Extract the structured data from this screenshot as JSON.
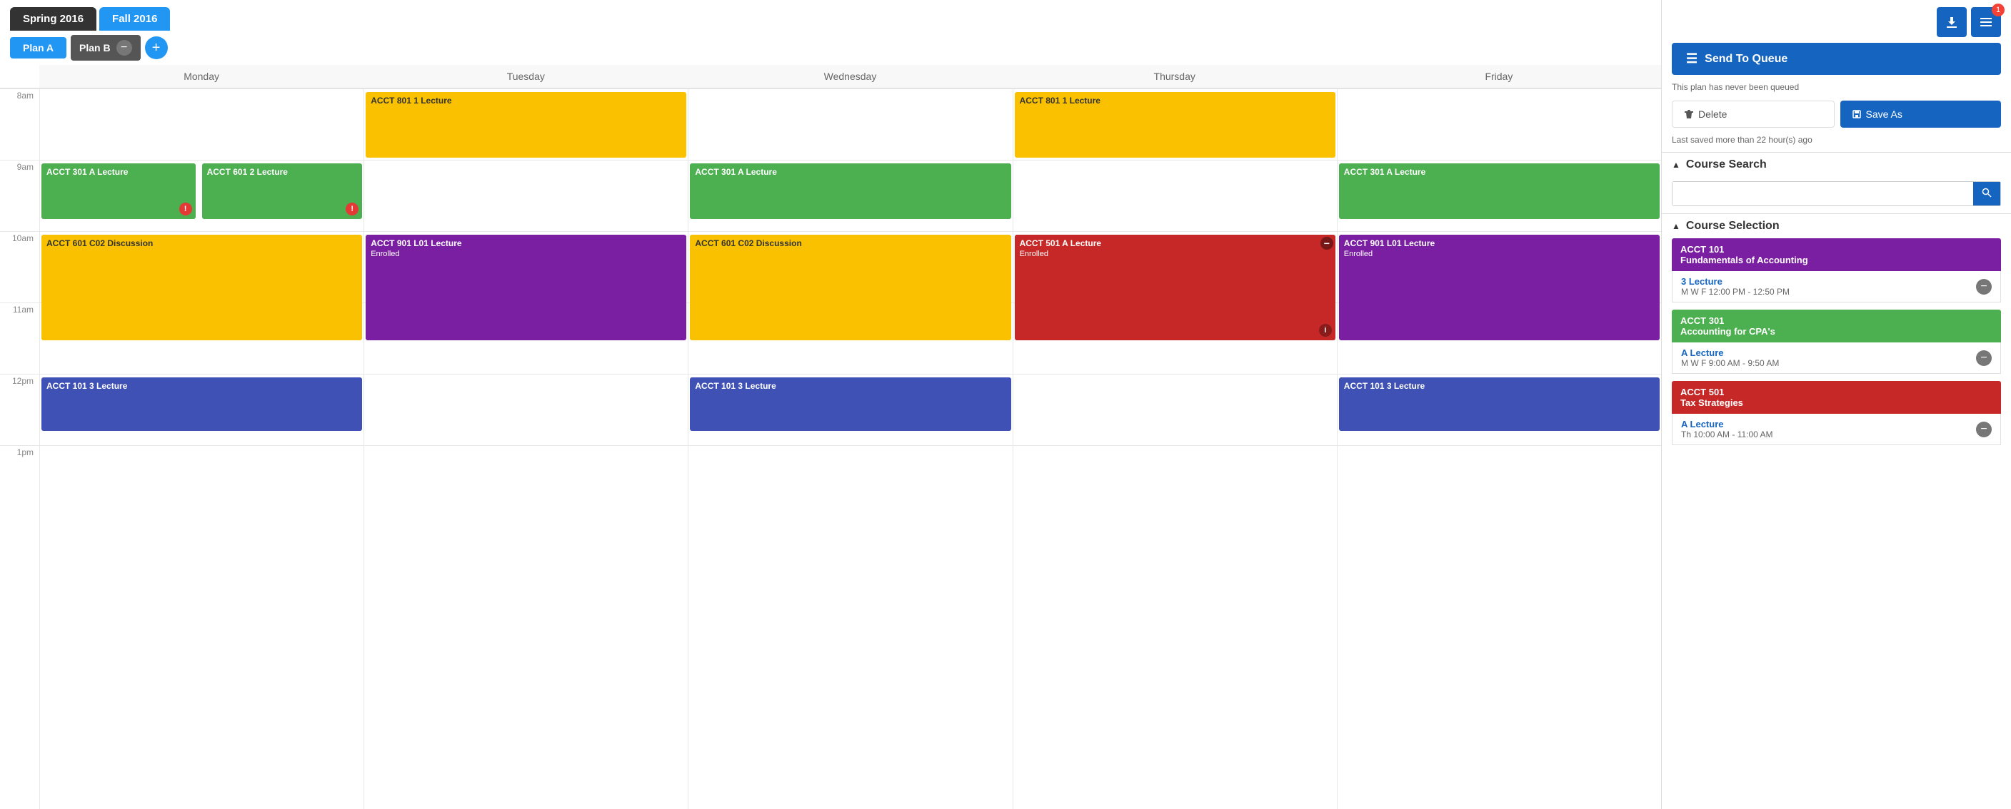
{
  "semesters": [
    {
      "label": "Spring 2016",
      "active": false
    },
    {
      "label": "Fall 2016",
      "active": true
    }
  ],
  "plans": [
    {
      "label": "Plan A",
      "active": true
    },
    {
      "label": "Plan B",
      "active": false
    }
  ],
  "calendar": {
    "days": [
      "Monday",
      "Tuesday",
      "Wednesday",
      "Thursday",
      "Friday"
    ],
    "times": [
      "8am",
      "9am",
      "10am",
      "11am",
      "12pm",
      "1pm"
    ],
    "courses": [
      {
        "id": "acct801-tue",
        "label": "ACCT 801 1 Lecture",
        "day": 1,
        "startSlot": 0,
        "height": 1,
        "color": "yellow",
        "enrolled": false
      },
      {
        "id": "acct801-thu",
        "label": "ACCT 801 1 Lecture",
        "day": 3,
        "startSlot": 0,
        "height": 1,
        "color": "yellow",
        "enrolled": false
      },
      {
        "id": "acct301-mon",
        "label": "ACCT 301 A Lecture",
        "day": 0,
        "startSlot": 1,
        "height": 0.8,
        "color": "green",
        "enrolled": false,
        "hasError": true
      },
      {
        "id": "acct601-mon",
        "label": "ACCT 601 2 Lecture",
        "day": 0,
        "startSlot": 1,
        "height": 0.8,
        "color": "green",
        "enrolled": false,
        "hasError": true,
        "offset": true
      },
      {
        "id": "acct301-wed",
        "label": "ACCT 301 A Lecture",
        "day": 2,
        "startSlot": 1,
        "height": 0.8,
        "color": "green",
        "enrolled": false
      },
      {
        "id": "acct301-fri",
        "label": "ACCT 301 A Lecture",
        "day": 4,
        "startSlot": 1,
        "height": 0.8,
        "color": "green",
        "enrolled": false
      },
      {
        "id": "acct601-mon-disc",
        "label": "ACCT 601 C02 Discussion",
        "day": 0,
        "startSlot": 2,
        "height": 1.5,
        "color": "yellow2",
        "enrolled": false
      },
      {
        "id": "acct901-tue",
        "label": "ACCT 901 L01 Lecture",
        "sub": "Enrolled",
        "day": 1,
        "startSlot": 2,
        "height": 1.5,
        "color": "purple",
        "enrolled": true
      },
      {
        "id": "acct601-wed-disc",
        "label": "ACCT 601 C02 Discussion",
        "day": 2,
        "startSlot": 2,
        "height": 1.5,
        "color": "yellow2",
        "enrolled": false
      },
      {
        "id": "acct501-thu",
        "label": "ACCT 501 A Lecture",
        "sub": "Enrolled",
        "day": 3,
        "startSlot": 2,
        "height": 1.5,
        "color": "red",
        "enrolled": true,
        "hasInfo": true,
        "hasRemove": true
      },
      {
        "id": "acct901-fri",
        "label": "ACCT 901 L01 Lecture",
        "sub": "Enrolled",
        "day": 4,
        "startSlot": 2,
        "height": 1.5,
        "color": "purple",
        "enrolled": true
      },
      {
        "id": "acct101-mon",
        "label": "ACCT 101 3 Lecture",
        "day": 0,
        "startSlot": 4,
        "height": 0.8,
        "color": "blue",
        "enrolled": false
      },
      {
        "id": "acct101-wed",
        "label": "ACCT 101 3 Lecture",
        "day": 2,
        "startSlot": 4,
        "height": 0.8,
        "color": "blue",
        "enrolled": false
      },
      {
        "id": "acct101-fri",
        "label": "ACCT 101 3 Lecture",
        "day": 4,
        "startSlot": 4,
        "height": 0.8,
        "color": "blue",
        "enrolled": false
      }
    ]
  },
  "sidebar": {
    "send_to_queue_label": "Send To Queue",
    "queue_note": "This plan has never been queued",
    "delete_label": "Delete",
    "save_as_label": "Save As",
    "save_note": "Last saved more than 22 hour(s) ago",
    "course_search_title": "Course Search",
    "search_placeholder": "",
    "course_selection_title": "Course Selection",
    "badge_count": "1",
    "courses": [
      {
        "label": "ACCT 101",
        "name": "Fundamentals of Accounting",
        "color": "purple",
        "sections": [
          {
            "label": "3 Lecture",
            "time": "M W F 12:00 PM - 12:50 PM"
          }
        ]
      },
      {
        "label": "ACCT 301",
        "name": "Accounting for CPA's",
        "color": "green",
        "sections": [
          {
            "label": "A Lecture",
            "time": "M W F 9:00 AM - 9:50 AM"
          }
        ]
      },
      {
        "label": "ACCT 501",
        "name": "Tax Strategies",
        "color": "red",
        "sections": [
          {
            "label": "A Lecture",
            "time": "Th 10:00 AM - 11:00 AM"
          }
        ]
      }
    ]
  }
}
